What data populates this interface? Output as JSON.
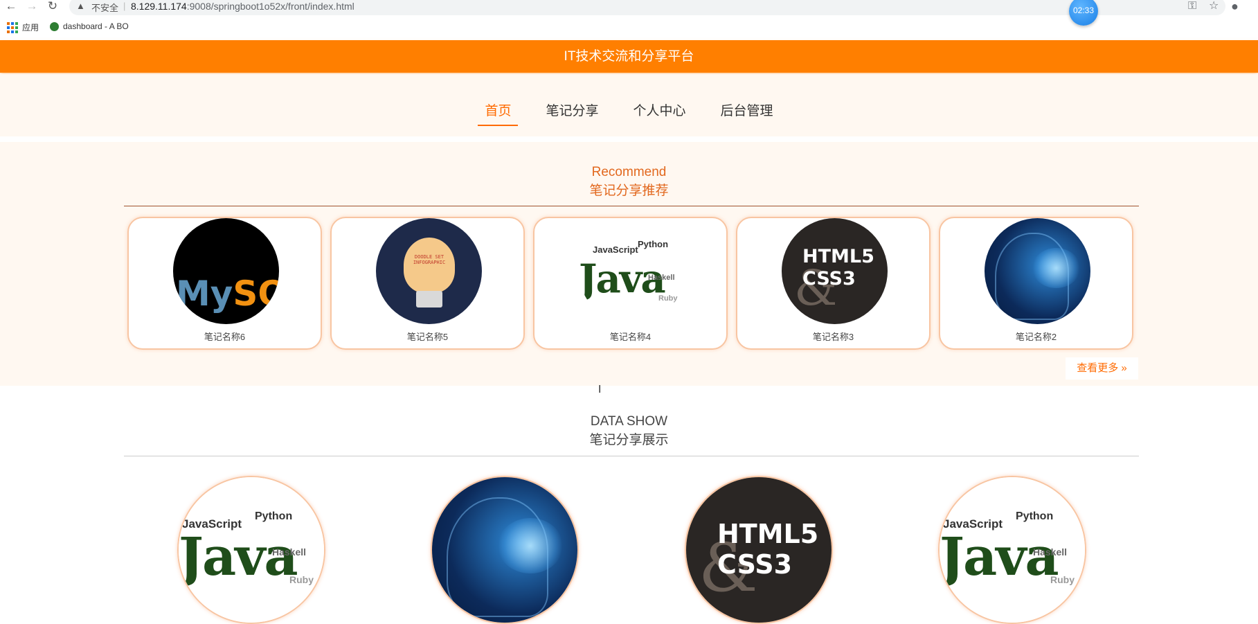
{
  "browser": {
    "insecure_label": "不安全",
    "url_host": "8.129.11.174",
    "url_path": ":9008/springboot1o52x/front/index.html",
    "clock_time": "02:33",
    "bookmarks": [
      {
        "label": "应用"
      },
      {
        "label": "dashboard - A BO"
      }
    ]
  },
  "header": {
    "title": "IT技术交流和分享平台"
  },
  "nav": {
    "items": [
      {
        "label": "首页",
        "active": true
      },
      {
        "label": "笔记分享",
        "active": false
      },
      {
        "label": "个人中心",
        "active": false
      },
      {
        "label": "后台管理",
        "active": false
      }
    ]
  },
  "recommend": {
    "title_en": "Recommend",
    "title_cn": "笔记分享推荐",
    "cards": [
      {
        "name": "笔记名称6",
        "image": "mysql-logo"
      },
      {
        "name": "笔记名称5",
        "image": "doodle-lightbulb"
      },
      {
        "name": "笔记名称4",
        "image": "java-word-cloud"
      },
      {
        "name": "笔记名称3",
        "image": "html5-css3-cover"
      },
      {
        "name": "笔记名称2",
        "image": "digital-brain"
      }
    ],
    "more_label": "查看更多"
  },
  "data_show": {
    "title_en": "DATA SHOW",
    "title_cn": "笔记分享展示",
    "items": [
      {
        "image": "java-word-cloud"
      },
      {
        "image": "digital-brain"
      },
      {
        "image": "html5-css3-cover"
      },
      {
        "image": "java-word-cloud"
      }
    ]
  },
  "colors": {
    "accent": "#ff7f00",
    "nav_active": "#ff6a00",
    "section_bg": "#fff8f1",
    "card_border": "#f8c5a2"
  }
}
